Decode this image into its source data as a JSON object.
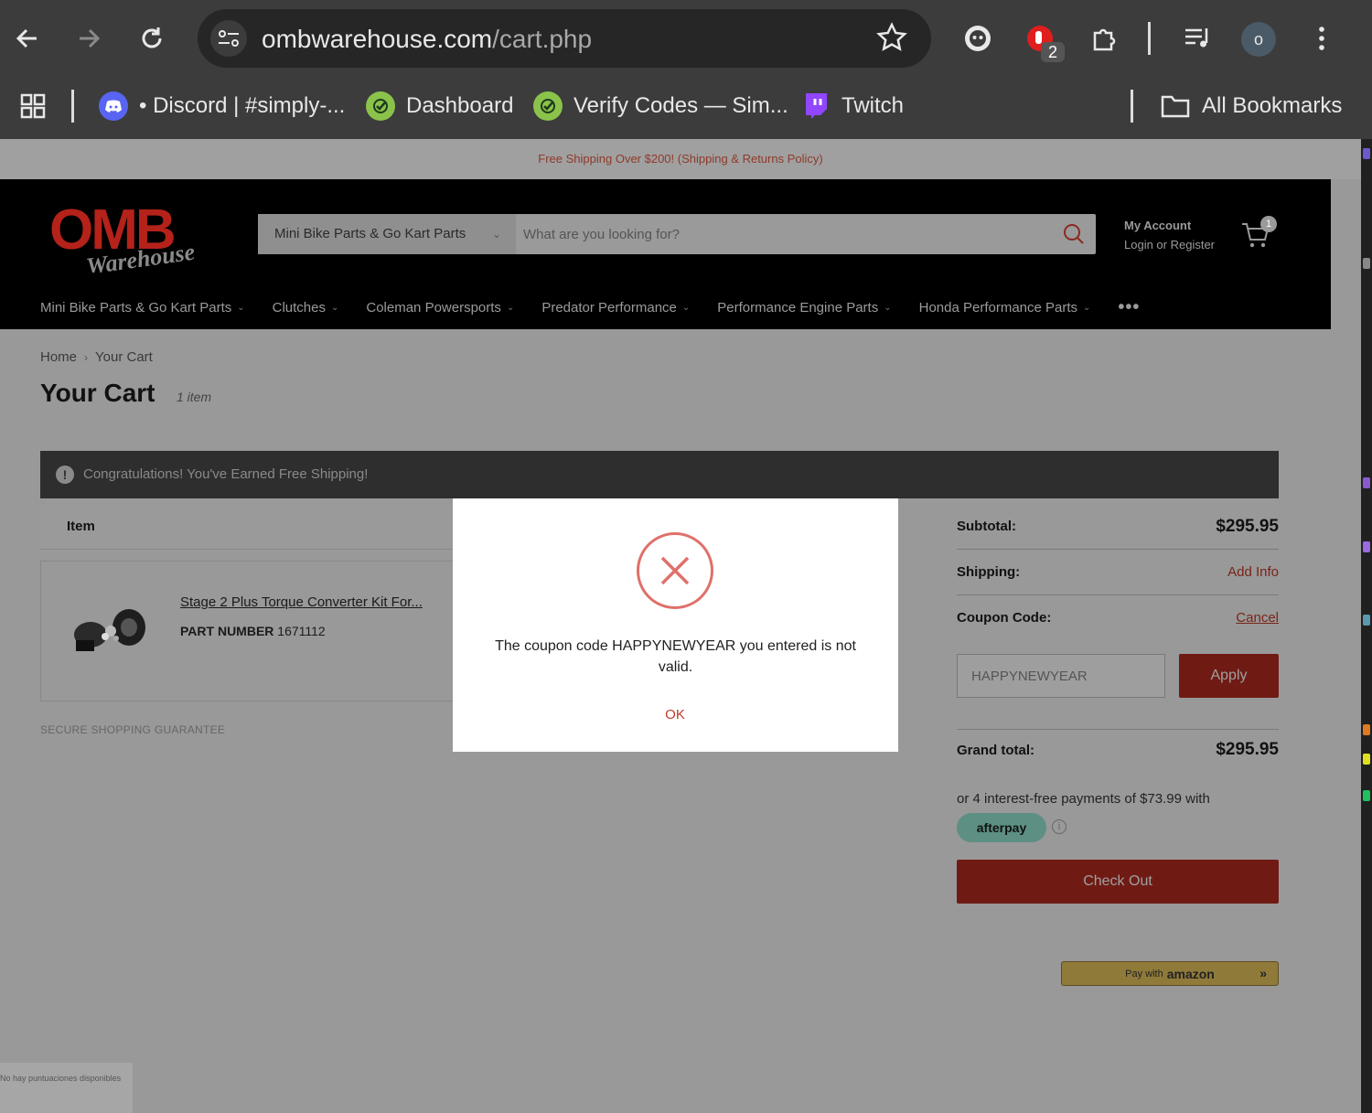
{
  "browser": {
    "url_domain": "ombwarehouse.com",
    "url_path": "/cart.php",
    "extension_badge": "2",
    "profile_initial": "o",
    "bookmarks": [
      {
        "label": "• Discord | #simply-...",
        "icon": "discord-icon",
        "color": "#5865f2"
      },
      {
        "label": "Dashboard",
        "icon": "check-logo-icon",
        "color": "#8bc34a"
      },
      {
        "label": "Verify Codes — Sim...",
        "icon": "check-logo-icon",
        "color": "#8bc34a"
      },
      {
        "label": "Twitch",
        "icon": "twitch-icon",
        "color": "#9146ff"
      }
    ],
    "all_bookmarks": "All Bookmarks"
  },
  "site": {
    "promo": "Free Shipping Over $200! (Shipping & Returns Policy)",
    "logo_text": "OMB",
    "logo_script": "Warehouse",
    "search_category": "Mini Bike Parts & Go Kart Parts",
    "search_placeholder": "What are you looking for?",
    "account_title": "My Account",
    "account_sub": "Login or Register",
    "cart_count": "1",
    "nav": [
      "Mini Bike Parts & Go Kart Parts",
      "Clutches",
      "Coleman Powersports",
      "Predator Performance",
      "Performance Engine Parts",
      "Honda Performance Parts"
    ],
    "nav_more": "•••"
  },
  "cart": {
    "breadcrumb_home": "Home",
    "breadcrumb_current": "Your Cart",
    "title": "Your Cart",
    "item_count": "1 item",
    "ship_banner": "Congratulations!  You've Earned Free Shipping!",
    "col_item": "Item",
    "product_name": "Stage 2 Plus Torque Converter Kit For...",
    "part_label": "PART NUMBER",
    "part_number": "1671112",
    "secure": "SECURE SHOPPING GUARANTEE"
  },
  "summary": {
    "subtotal_label": "Subtotal:",
    "subtotal_value": "$295.95",
    "shipping_label": "Shipping:",
    "shipping_link": "Add Info",
    "coupon_label": "Coupon Code:",
    "coupon_cancel": "Cancel",
    "coupon_value": "HAPPYNEWYEAR",
    "apply": "Apply",
    "grand_label": "Grand total:",
    "grand_value": "$295.95",
    "afterpay_text": "or 4 interest-free payments of $73.99 with",
    "afterpay_badge": "afterpay",
    "checkout": "Check Out",
    "amazon_pay": "Pay with",
    "amazon_brand": "amazon"
  },
  "modal": {
    "message": "The coupon code HAPPYNEWYEAR you entered is not valid.",
    "ok": "OK"
  },
  "recaptcha_text": "No hay puntuaciones disponibles"
}
